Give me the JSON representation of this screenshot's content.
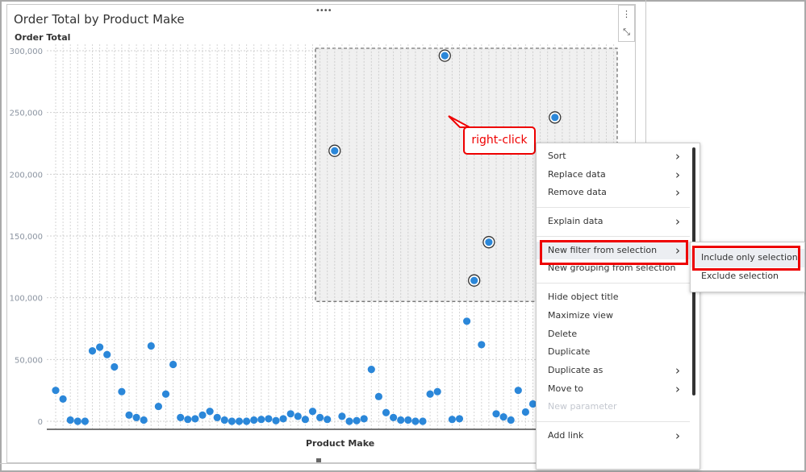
{
  "chart_data": {
    "type": "scatter",
    "title": "Order Total by Product Make",
    "ylabel": "Order Total",
    "xlabel": "Product Make",
    "ylim": [
      0,
      300000
    ],
    "yticks": [
      "0",
      "50,000",
      "100,000",
      "150,000",
      "200,000",
      "250,000",
      "300,000"
    ],
    "ytick_values": [
      0,
      50000,
      100000,
      150000,
      200000,
      250000,
      300000
    ],
    "grid": true,
    "category_count": 77,
    "values": [
      25000,
      18000,
      1000,
      0,
      0,
      57000,
      60000,
      54000,
      44000,
      24000,
      5000,
      3000,
      1000,
      61000,
      12000,
      22000,
      46000,
      3000,
      1500,
      2000,
      5000,
      8000,
      3000,
      1000,
      0,
      0,
      0,
      1000,
      1500,
      2000,
      500,
      2000,
      6000,
      4000,
      1500,
      8000,
      3000,
      1500,
      219000,
      4000,
      0,
      500,
      2000,
      42000,
      20000,
      7000,
      3000,
      1000,
      1000,
      0,
      0,
      22000,
      24000,
      296000,
      1500,
      2000,
      81000,
      114000,
      62000,
      145000,
      6000,
      3500,
      1000,
      25000,
      7500,
      14000,
      null,
      null,
      246000,
      null,
      null,
      null,
      null,
      null,
      null,
      null,
      null
    ],
    "selected_indices": [
      38,
      53,
      57,
      59,
      68
    ],
    "point_color": "#2b87d9",
    "selection_box": {
      "y_range": [
        97000,
        302000
      ]
    }
  },
  "toolbar": {
    "drag_icon": "drag-handle-icon",
    "more_icon": "kebab-icon",
    "maximize_icon": "expand-icon"
  },
  "annotation": {
    "callout": "right-click",
    "highlight_color": "#e00000"
  },
  "context_menu": {
    "groups": [
      [
        {
          "label": "Sort",
          "submenu": true
        },
        {
          "label": "Replace data",
          "submenu": true
        },
        {
          "label": "Remove data",
          "submenu": true
        }
      ],
      [
        {
          "label": "Explain data",
          "submenu": true
        }
      ],
      [
        {
          "label": "New filter from selection",
          "submenu": true,
          "highlighted": true
        },
        {
          "label": "New grouping from selection",
          "submenu": false
        }
      ],
      [
        {
          "label": "Hide object title"
        },
        {
          "label": "Maximize view"
        },
        {
          "label": "Delete"
        },
        {
          "label": "Duplicate"
        },
        {
          "label": "Duplicate as",
          "submenu": true
        },
        {
          "label": "Move to",
          "submenu": true
        },
        {
          "label": "New parameter",
          "disabled": true
        }
      ],
      [
        {
          "label": "Add link",
          "submenu": true
        }
      ]
    ]
  },
  "submenu": {
    "items": [
      {
        "label": "Include only selection",
        "highlighted": true
      },
      {
        "label": "Exclude selection"
      }
    ]
  }
}
